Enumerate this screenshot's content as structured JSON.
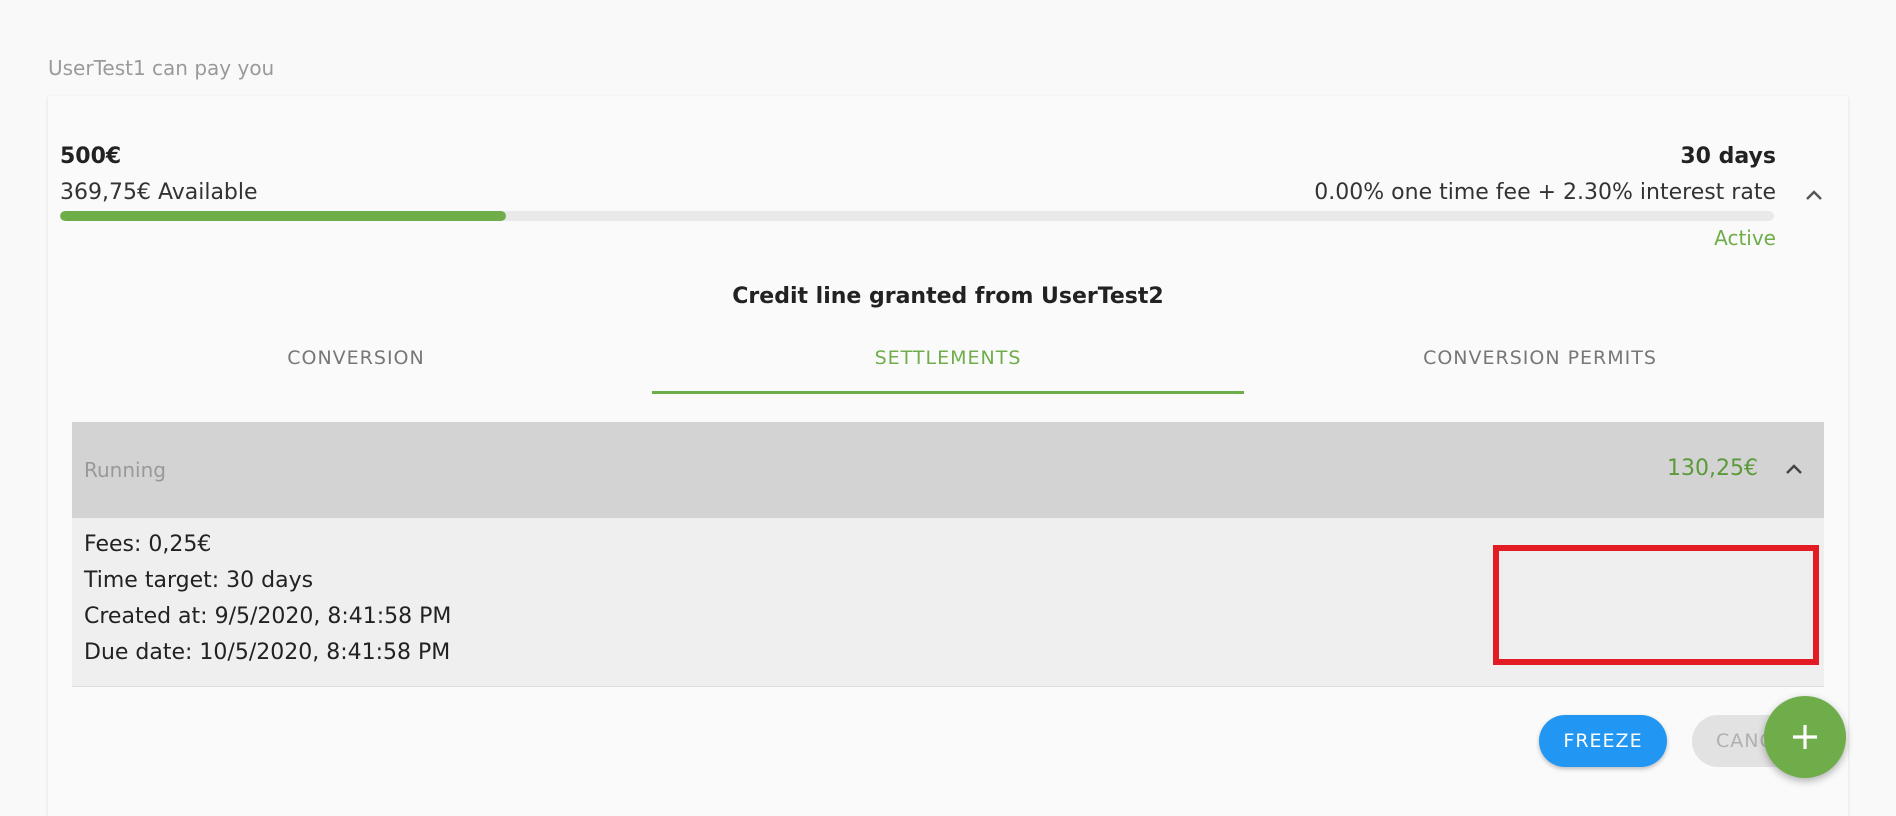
{
  "section": {
    "title": "UserTest1 can pay you"
  },
  "credit_line": {
    "amount": "500€",
    "available": "369,75€ Available",
    "term": "30 days",
    "fee_text": "0.00% one time fee + 2.30% interest rate",
    "usage_progress": 0.26,
    "status": "Active",
    "heading": "Credit line granted from UserTest2"
  },
  "tabs": [
    {
      "label": "CONVERSION"
    },
    {
      "label": "SETTLEMENTS"
    },
    {
      "label": "CONVERSION PERMITS"
    }
  ],
  "active_tab": "SETTLEMENTS",
  "settlement": {
    "status": "Running",
    "amount": "130,25€",
    "fees": "Fees: 0,25€",
    "time_target": "Time target: 30 days",
    "created_at": "Created at: 9/5/2020, 8:41:58 PM",
    "due_date": "Due date: 10/5/2020, 8:41:58 PM"
  },
  "actions": {
    "freeze": "FREEZE",
    "cancel": "CANC"
  },
  "icons": {
    "collapse": "chevron-up-icon",
    "fab": "plus-icon"
  },
  "colors": {
    "accent_green": "#6fad4a",
    "freeze_blue": "#2196f3",
    "highlight_red": "#e31b23"
  }
}
